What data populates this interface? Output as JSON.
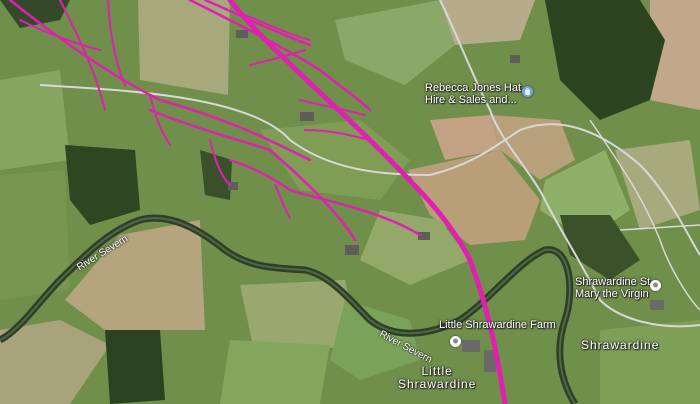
{
  "places": {
    "hat_shop": {
      "line1": "Rebecca Jones Hat",
      "line2": "Hire & Sales and..."
    },
    "church": {
      "line1": "Shrawardine St",
      "line2": "Mary the Virgin"
    },
    "farm": {
      "name": "Little Shrawardine Farm"
    },
    "village": {
      "name": "Shrawardine"
    },
    "hamlet": {
      "line1": "Little",
      "line2": "Shrawardine"
    }
  },
  "rivers": {
    "label_1": "River Severn",
    "label_2": "River Severn"
  },
  "icons": {
    "shop_pin": "shop-pin-icon",
    "church_pin": "place-pin-icon",
    "farm_pin": "place-pin-icon"
  },
  "colors": {
    "route_lines": "#e020b0",
    "road": "#d8d8d8",
    "river": "#2f3f2c",
    "label_text": "#ffffff",
    "shop_pin": "#6aa7f2"
  }
}
